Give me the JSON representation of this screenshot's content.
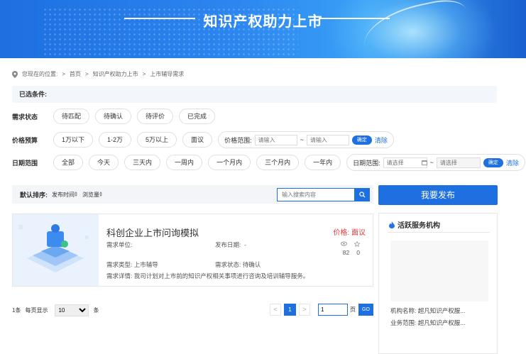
{
  "banner": {
    "title": "知识产权助力上市"
  },
  "breadcrumb": {
    "prefix": "您现在的位置:",
    "items": [
      "首页",
      "知识产权助力上市",
      "上市辅导需求"
    ],
    "sep": ">"
  },
  "conditions": {
    "label": "已选条件:"
  },
  "filters": {
    "status": {
      "label": "需求状态",
      "options": [
        "待匹配",
        "待确认",
        "待评价",
        "已完成"
      ]
    },
    "budget": {
      "label": "价格预算",
      "options": [
        "1万以下",
        "1-2万",
        "5万以上",
        "面议"
      ],
      "range_label": "价格范围:",
      "placeholder_min": "请输入",
      "placeholder_max": "请输入",
      "tilde": "~",
      "confirm": "确定",
      "clear": "清除"
    },
    "date": {
      "label": "日期范围",
      "options": [
        "全部",
        "今天",
        "三天内",
        "一周内",
        "一个月内",
        "三个月内",
        "一年内"
      ],
      "range_label": "日期范围:",
      "placeholder_start": "请选择",
      "placeholder_end": "请选择",
      "tilde": "~",
      "confirm": "确定",
      "clear": "清除"
    }
  },
  "sort": {
    "label": "默认排序:",
    "by_date": "发布时间",
    "by_views": "浏览量"
  },
  "search": {
    "placeholder": "输入搜索内容"
  },
  "publish_button": "我要发布",
  "listing": {
    "title": "科创企业上市问询模拟",
    "price": "价格: 面议",
    "unit_label": "需求单位:",
    "date_label": "发布日期:",
    "date_value": "-",
    "views": "82",
    "favorites": "0",
    "type": "需求类型:  上市辅导",
    "status": "需求状态:  待确认",
    "detail": "需求详情:  我司计划对上市前的知识产权相关事项进行咨询及培训辅导服务。"
  },
  "pager": {
    "count": "1条",
    "per_page_label": "每页显示",
    "per_page": "10",
    "unit": "条",
    "current": "1",
    "goto_value": "1",
    "page_unit": "页",
    "go": "GO",
    "prev": "<",
    "next": ">"
  },
  "sidebar": {
    "title": "活跃服务机构",
    "org_name": "机构名称: 超凡知识产权服...",
    "org_scope": "业务范围: 超凡知识产权服..."
  },
  "colors": {
    "primary": "#1e6fe0",
    "price_red": "#e03b3b",
    "flame": "#ff6a28"
  }
}
